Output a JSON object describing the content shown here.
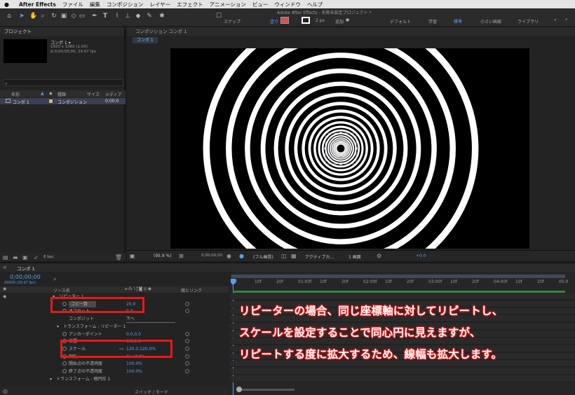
{
  "menubar": {
    "app": "After Effects",
    "items": [
      "ファイル",
      "編集",
      "コンポジション",
      "レイヤー",
      "エフェクト",
      "アニメーション",
      "ビュー",
      "ウィンドウ",
      "ヘルプ"
    ]
  },
  "toolbar": {
    "window_title": "Adobe After Effects - 名称未設定プロジェクト *",
    "snap_label": "スナップ",
    "fill_label": "塗り",
    "stroke_width": "2 px",
    "add_label": "追加",
    "workspaces": [
      "デフォルト",
      "学習",
      "標準",
      "小さい画面",
      "ライブラリ"
    ],
    "active_workspace": "標準"
  },
  "project": {
    "title": "プロジェクト",
    "comp_name": "コンポ 1 ▾",
    "comp_size": "1920 x 1080 (1.00)",
    "comp_duration": "Δ 0;00;05;00, 29.97 fps",
    "columns": {
      "name": "名前",
      "type": "種類",
      "size": "サイズ",
      "media": "メディア"
    },
    "item": {
      "name": "コンポ 1",
      "type": "コンポジション",
      "dur": "0;00;0"
    },
    "bpc": "8 bpc"
  },
  "composition": {
    "panel_title": "コンポジション コンポ 1",
    "tab": "コンポ 1",
    "zoom": "(95.9 %)",
    "timecode": "0;00;00;00",
    "quality": "(フル画質)",
    "camera": "アクティブカ...",
    "views": "1 画面",
    "offset": "+0.0"
  },
  "timeline": {
    "tab": "コンポ 1",
    "current_time": "0;00;00;00",
    "frame_info": "00000 (29.97 fps)",
    "col_source": "ソース名",
    "col_parent": "親とリンク",
    "switch_mode": "スイッチ / モード",
    "ruler": [
      "0f",
      "10f",
      "20f",
      "01:00f",
      "10f",
      "20f",
      "02:00f",
      "10f",
      "20f",
      "03:00f",
      "10f",
      "20f",
      "04:00f",
      "10f",
      "20f",
      "05:0"
    ],
    "layers": [
      {
        "label": "リピーター 1",
        "value": ""
      },
      {
        "label": "コピー数",
        "value": "20.0"
      },
      {
        "label": "オフセット",
        "value": "0.0"
      },
      {
        "label": "コンポジット",
        "value": "下へ"
      },
      {
        "label": "トランスフォーム : リピーター 1",
        "value": ""
      },
      {
        "label": "アンカーポイント",
        "value": "0.0,0.0"
      },
      {
        "label": "位置",
        "value": "0.0,0.0"
      },
      {
        "label": "スケール",
        "value": "120.0,120.0%"
      },
      {
        "label": "回転",
        "value": "0x+0.0°"
      },
      {
        "label": "開始点の不透明度",
        "value": "100.0%"
      },
      {
        "label": "終了点の不透明度",
        "value": "100.0%"
      },
      {
        "label": "トランスフォーム : 楕円形 1",
        "value": ""
      }
    ]
  },
  "annotation": [
    "リピーターの場合、同じ座標軸に対してリピートし、",
    "スケールを設定することで同心円に見えますが、",
    "リピートする度に拡大するため、線幅も拡大します。"
  ],
  "colors": {
    "annotation_glow": "#ff2020",
    "highlight_box": "#e81818",
    "value_blue": "#5a9ff0"
  }
}
